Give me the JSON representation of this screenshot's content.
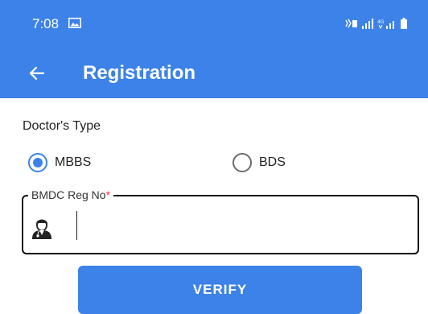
{
  "status_bar": {
    "time": "7:08",
    "icons": [
      "gallery-icon",
      "volte-icon",
      "signal-icon",
      "4g-signal-icon",
      "battery-icon"
    ]
  },
  "toolbar": {
    "title": "Registration",
    "back_icon": "back-arrow-icon"
  },
  "form": {
    "doctor_type_label": "Doctor's Type",
    "options": [
      {
        "label": "MBBS",
        "selected": true
      },
      {
        "label": "BDS",
        "selected": false
      }
    ],
    "reg_field": {
      "label": "BMDC Reg No",
      "required_mark": "*",
      "value": "",
      "icon": "doctor-icon"
    },
    "verify_label": "VERIFY"
  },
  "colors": {
    "primary": "#3c82e8",
    "required": "#e53935",
    "text": "#222222"
  }
}
